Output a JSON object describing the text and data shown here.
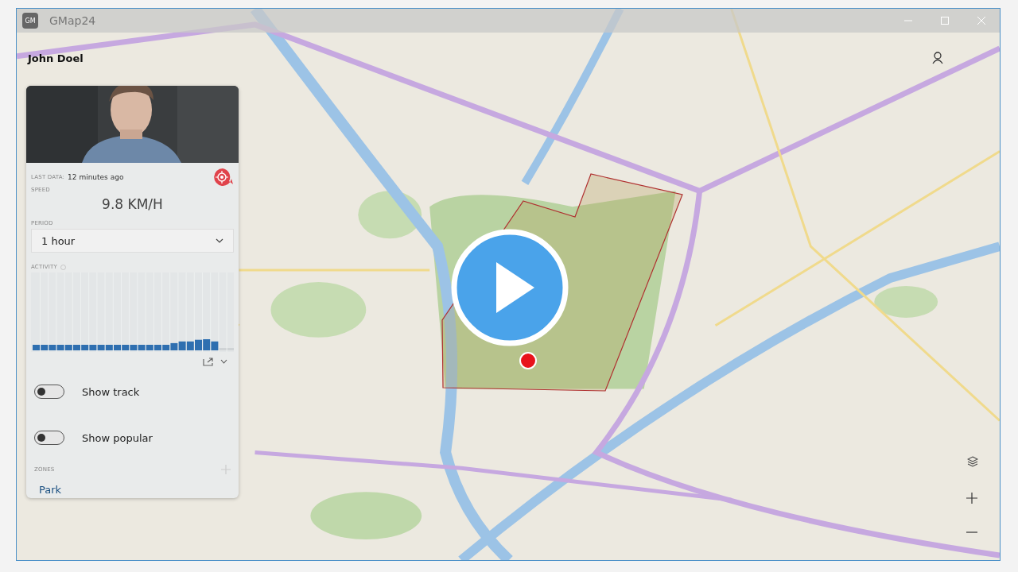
{
  "window": {
    "title": "GMap24",
    "app_badge": "GM"
  },
  "user": {
    "name": "John Doel"
  },
  "panel": {
    "last_data_label": "LAST DATA:",
    "last_data": "12 minutes ago",
    "speed_label": "SPEED",
    "speed": "9.8 KM/H",
    "period_label": "PERIOD",
    "period": "1 hour",
    "activity_label": "ACTIVITY",
    "toggles": [
      {
        "label": "Show track",
        "on": false
      },
      {
        "label": "Show popular",
        "on": false
      }
    ],
    "zones_label": "ZONES",
    "zones": [
      {
        "name": "Park"
      }
    ]
  }
}
